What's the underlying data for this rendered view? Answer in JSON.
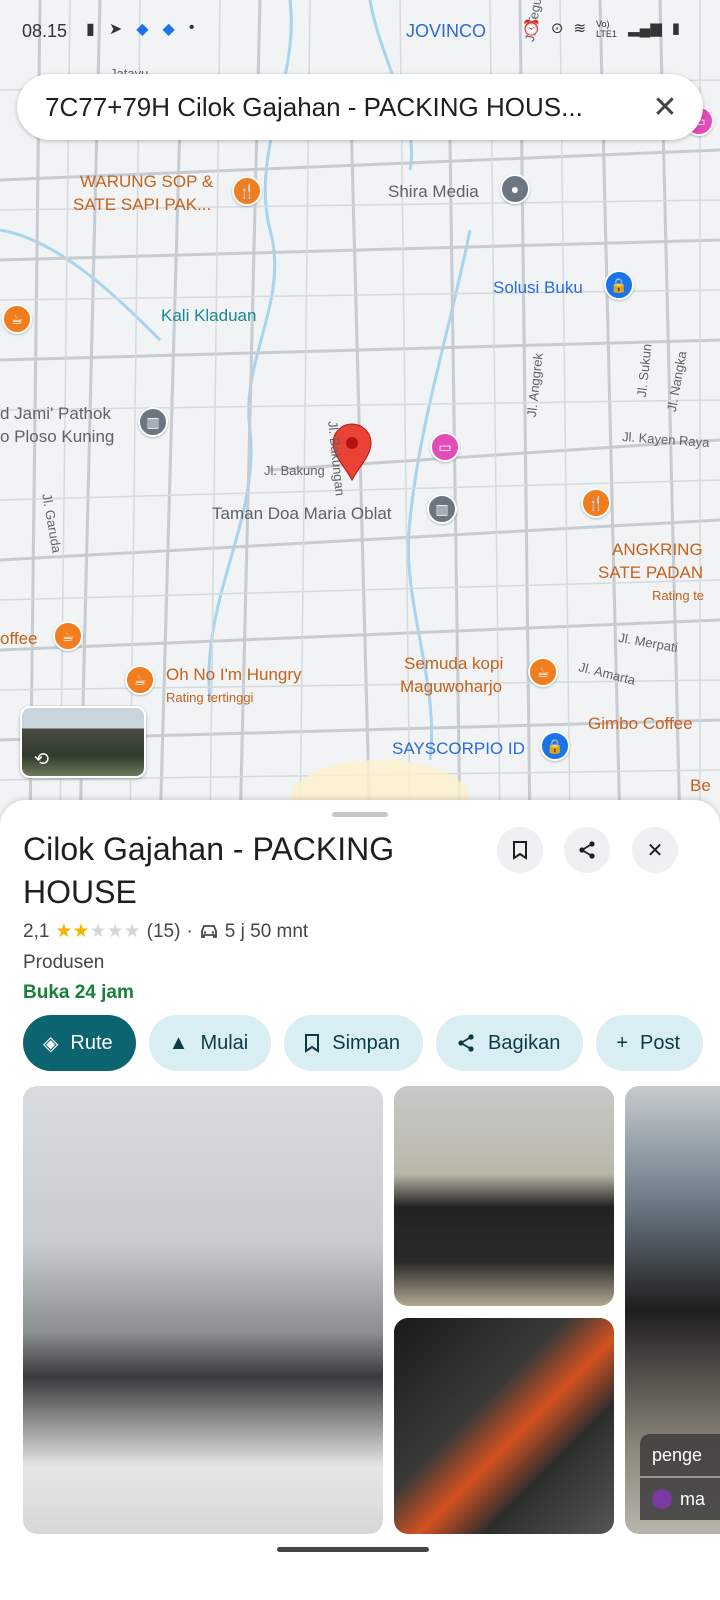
{
  "status_bar": {
    "time": "08.15",
    "carrier": "JOVINCO",
    "signal": "Vo) LTE1"
  },
  "search": {
    "query": "7C77+79H Cilok Gajahan - PACKING HOUS..."
  },
  "map": {
    "labels": {
      "warung": "WARUNG SOP &",
      "warung2": "SATE SAPI PAK...",
      "shira": "Shira Media",
      "solusi": "Solusi Buku",
      "kali": "Kali Kladuan",
      "jami": "d Jami' Pathok",
      "ploso": "o Ploso Kuning",
      "taman": "Taman Doa Maria Oblat",
      "angkring": "ANGKRING",
      "sate_padan": "SATE PADAN",
      "rating_te": "Rating te",
      "coffee": "offee",
      "ohno": "Oh No I'm Hungry",
      "ohno_sub": "Rating tertinggi",
      "semuda": "Semuda kopi",
      "semuda2": "Maguwoharjo",
      "gimbo": "Gimbo Coffee",
      "sayscorpio": "SAYSCORPIO ID",
      "be": "Be",
      "oh": "oh"
    },
    "streets": {
      "jatayu": "Jatayu",
      "teguh": "Jl. Teguh",
      "bakungan": "Jl. Bakungan",
      "bakung": "Jl. Bakung",
      "anggrek": "Jl. Anggrek",
      "sukun": "Jl. Sukun",
      "nangka": "Jl. Nangka",
      "kayen": "Jl. Kayen Raya",
      "garuda": "Jl. Garuda",
      "merpati": "Jl. Merpati",
      "amarta": "Jl. Amarta"
    }
  },
  "place": {
    "title": "Cilok Gajahan - PACKING HOUSE",
    "rating": "2,1",
    "stars_filled": 2,
    "reviews": "(15)",
    "separator": "·",
    "drive_time": "5 j 50 mnt",
    "category": "Produsen",
    "hours": "Buka 24 jam"
  },
  "actions": [
    {
      "label": "Rute",
      "icon": "directions-icon"
    },
    {
      "label": "Mulai",
      "icon": "navigation-icon"
    },
    {
      "label": "Simpan",
      "icon": "bookmark-icon"
    },
    {
      "label": "Bagikan",
      "icon": "share-icon"
    },
    {
      "label": "Post",
      "icon": "plus-icon"
    }
  ],
  "photo_tags": {
    "tag1": "penge",
    "tag2": "ma"
  },
  "colors": {
    "primary": "#0b6470",
    "chip": "#d8eef2",
    "open": "#188038",
    "star": "#f5b400",
    "pin": "#ea4335"
  }
}
